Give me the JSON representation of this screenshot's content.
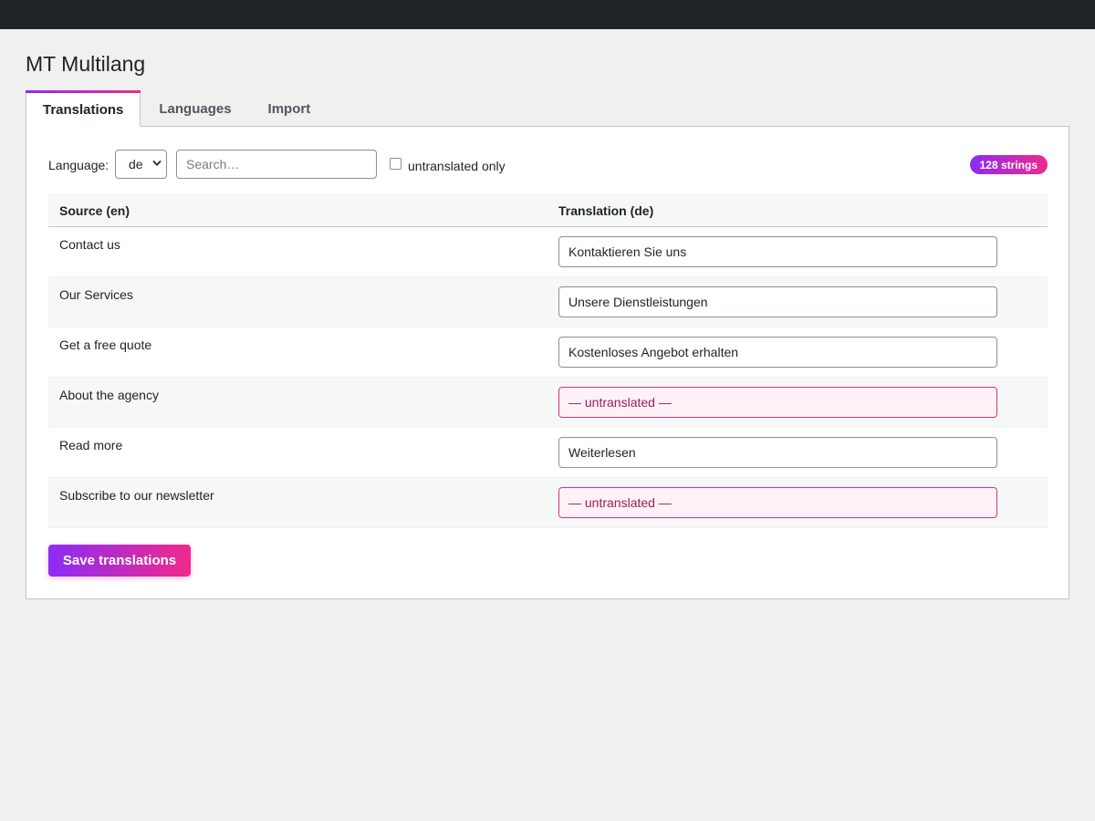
{
  "page_title": "MT Multilang",
  "tabs": [
    {
      "label": "Translations",
      "active": true
    },
    {
      "label": "Languages",
      "active": false
    },
    {
      "label": "Import",
      "active": false
    }
  ],
  "filters": {
    "language_label": "Language:",
    "language_value": "de",
    "search_placeholder": "Search…",
    "untranslated_only_label": "untranslated only",
    "untranslated_only_checked": false
  },
  "count_badge": "128 strings",
  "table": {
    "headers": {
      "source": "Source (en)",
      "translation": "Translation (de)"
    },
    "rows": [
      {
        "source": "Contact us",
        "translation": "Kontaktieren Sie uns",
        "untranslated": false
      },
      {
        "source": "Our Services",
        "translation": "Unsere Dienstleistungen",
        "untranslated": false
      },
      {
        "source": "Get a free quote",
        "translation": "Kostenloses Angebot erhalten",
        "untranslated": false
      },
      {
        "source": "About the agency",
        "translation": "— untranslated —",
        "untranslated": true
      },
      {
        "source": "Read more",
        "translation": "Weiterlesen",
        "untranslated": false
      },
      {
        "source": "Subscribe to our newsletter",
        "translation": "— untranslated —",
        "untranslated": true
      }
    ]
  },
  "save_button": "Save translations",
  "colors": {
    "topbar": "#1d2327",
    "accent_start": "#8b2cf5",
    "accent_end": "#f0298b",
    "untranslated_border": "#d63384"
  }
}
